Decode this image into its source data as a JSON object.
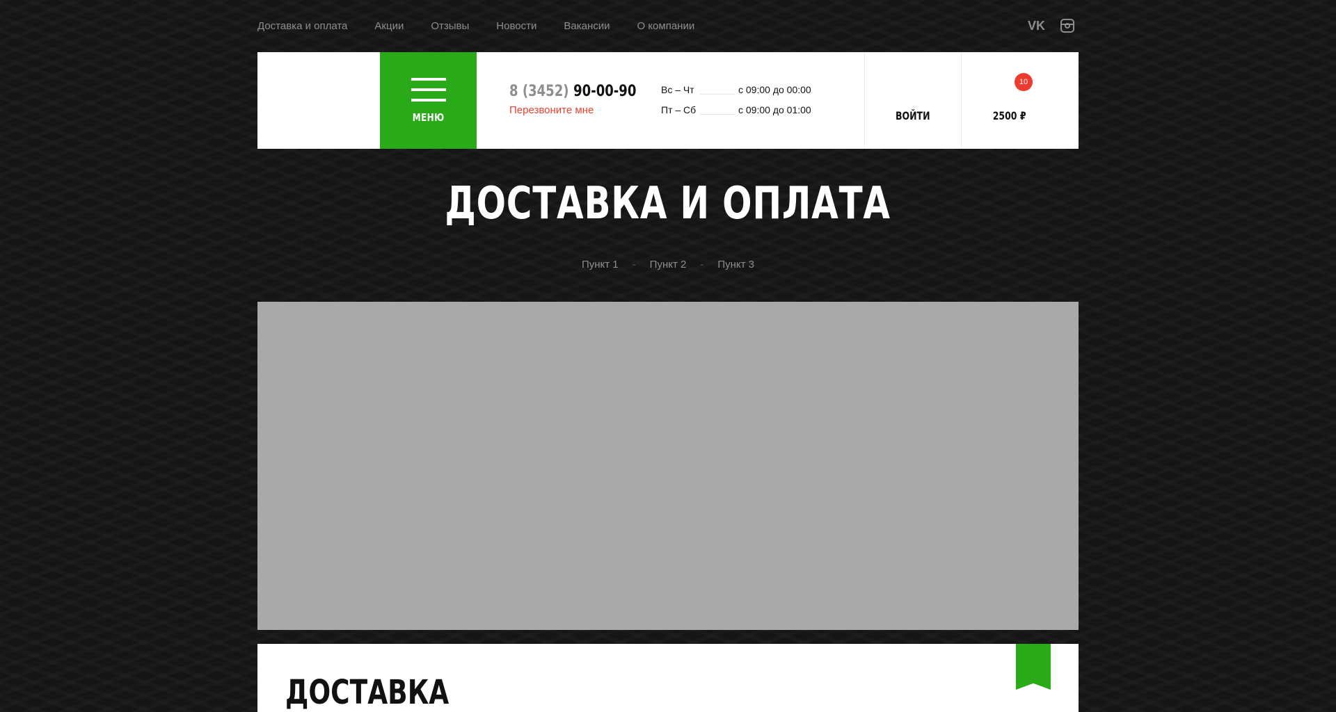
{
  "topnav": {
    "items": [
      {
        "label": "Доставка и оплата"
      },
      {
        "label": "Акции"
      },
      {
        "label": "Отзывы"
      },
      {
        "label": "Новости"
      },
      {
        "label": "Вакансии"
      },
      {
        "label": "О компании"
      }
    ],
    "social": {
      "vk_label": "VK",
      "vk_icon": "vk-icon",
      "instagram_icon": "instagram-icon"
    }
  },
  "header": {
    "menu_label": "МЕНЮ",
    "phone_code": "8 (3452)",
    "phone_number": "90-00-90",
    "callback": "Перезвоните мне",
    "hours": [
      {
        "days": "Вс – Чт",
        "time": "с 09:00 до 00:00"
      },
      {
        "days": "Пт – Сб",
        "time": "с 09:00 до 01:00"
      }
    ],
    "login": "ВОЙТИ",
    "cart_count": "10",
    "cart_sum": "2500 ₽"
  },
  "page": {
    "title": "ДОСТАВКА И ОПЛАТА",
    "breadcrumbs": [
      "Пункт 1",
      "Пункт 2",
      "Пункт 3"
    ],
    "section_title": "ДОСТАВКА"
  },
  "colors": {
    "accent_green": "#2aaa18",
    "accent_red": "#e7422e",
    "background": "#151515"
  }
}
